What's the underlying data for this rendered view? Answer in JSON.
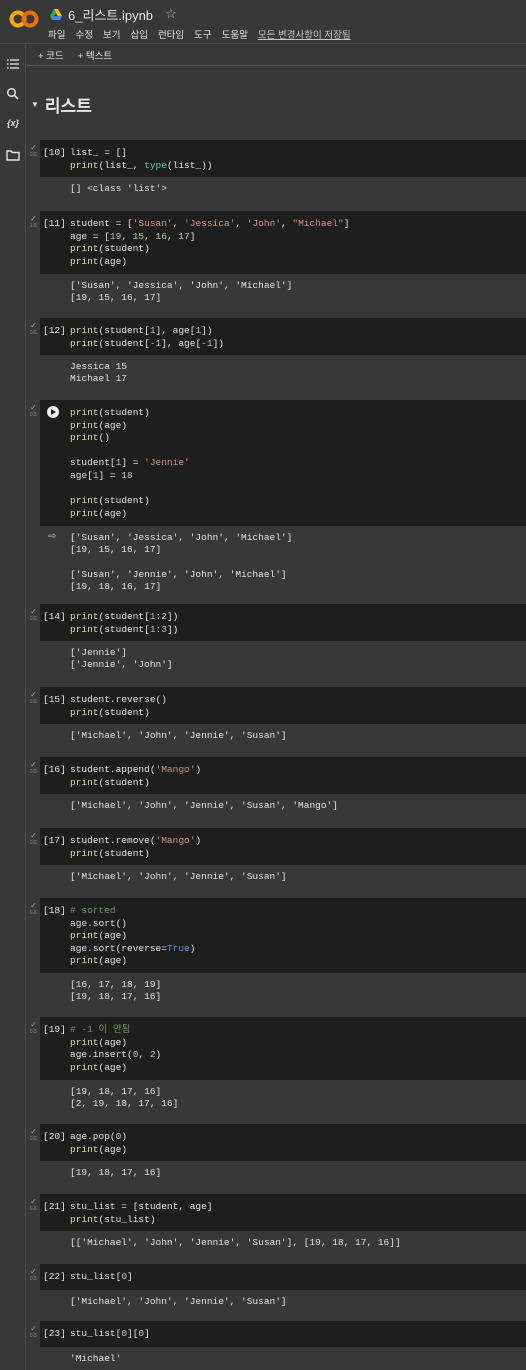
{
  "header": {
    "title": "6_리스트.ipynb",
    "star": "☆",
    "menu": [
      "파일",
      "수정",
      "보기",
      "삽입",
      "런타임",
      "도구",
      "도움말"
    ],
    "saved": "모든 변경사항이 저장됨"
  },
  "toolbar": {
    "add_code": "+ 코드",
    "add_text": "+ 텍스트"
  },
  "section": {
    "title": "리스트"
  },
  "sidebar": {
    "variables_label": "{x}"
  },
  "cells": [
    {
      "prompt": "[10]",
      "time": "0초",
      "out": "[] <class 'list'>"
    },
    {
      "prompt": "[11]",
      "time": "1초",
      "out": "['Susan', 'Jessica', 'John', 'Michael']\n[19, 15, 16, 17]"
    },
    {
      "prompt": "[12]",
      "time": "0초",
      "out": "Jessica 15\nMichael 17"
    },
    {
      "prompt": "",
      "time": "0초",
      "out": "['Susan', 'Jessica', 'John', 'Michael']\n[19, 15, 16, 17]\n\n['Susan', 'Jennie', 'John', 'Michael']\n[19, 18, 16, 17]"
    },
    {
      "prompt": "[14]",
      "time": "0초",
      "out": "['Jennie']\n['Jennie', 'John']"
    },
    {
      "prompt": "[15]",
      "time": "0초",
      "out": "['Michael', 'John', 'Jennie', 'Susan']"
    },
    {
      "prompt": "[16]",
      "time": "0초",
      "out": "['Michael', 'John', 'Jennie', 'Susan', 'Mango']"
    },
    {
      "prompt": "[17]",
      "time": "0초",
      "out": "['Michael', 'John', 'Jennie', 'Susan']"
    },
    {
      "prompt": "[18]",
      "time": "0초",
      "out": "[16, 17, 18, 19]\n[19, 18, 17, 16]"
    },
    {
      "prompt": "[19]",
      "time": "0초",
      "out": "[19, 18, 17, 16]\n[2, 19, 18, 17, 16]"
    },
    {
      "prompt": "[20]",
      "time": "0초",
      "out": "[19, 18, 17, 16]"
    },
    {
      "prompt": "[21]",
      "time": "0초",
      "out": "[['Michael', 'John', 'Jennie', 'Susan'], [19, 18, 17, 16]]"
    },
    {
      "prompt": "[22]",
      "time": "0초",
      "out": "['Michael', 'John', 'Jennie', 'Susan']"
    },
    {
      "prompt": "[23]",
      "time": "0초",
      "out": "'Michael'"
    }
  ],
  "code": [
    [
      "list_ = []",
      "print(list_, type(list_))"
    ],
    [
      "student = ['Susan', 'Jessica', 'John', \"Michael\"]",
      "age = [19, 15, 16, 17]",
      "print(student)",
      "print(age)"
    ],
    [
      "print(student[1], age[1])",
      "print(student[-1], age[-1])"
    ],
    [
      "print(student)",
      "print(age)",
      "print()",
      "",
      "student[1] = 'Jennie'",
      "age[1] = 18",
      "",
      "print(student)",
      "print(age)"
    ],
    [
      "print(student[1:2])",
      "print(student[1:3])"
    ],
    [
      "student.reverse()",
      "print(student)"
    ],
    [
      "student.append('Mango')",
      "print(student)"
    ],
    [
      "student.remove('Mango')",
      "print(student)"
    ],
    [
      "# sorted",
      "age.sort()",
      "print(age)",
      "age.sort(reverse=True)",
      "print(age)"
    ],
    [
      "# -1 이 안됨",
      "print(age)",
      "age.insert(0, 2)",
      "print(age)"
    ],
    [
      "age.pop(0)",
      "print(age)"
    ],
    [
      "stu_list = [student, age]",
      "print(stu_list)"
    ],
    [
      "stu_list[0]"
    ],
    [
      "stu_list[0][0]"
    ]
  ]
}
